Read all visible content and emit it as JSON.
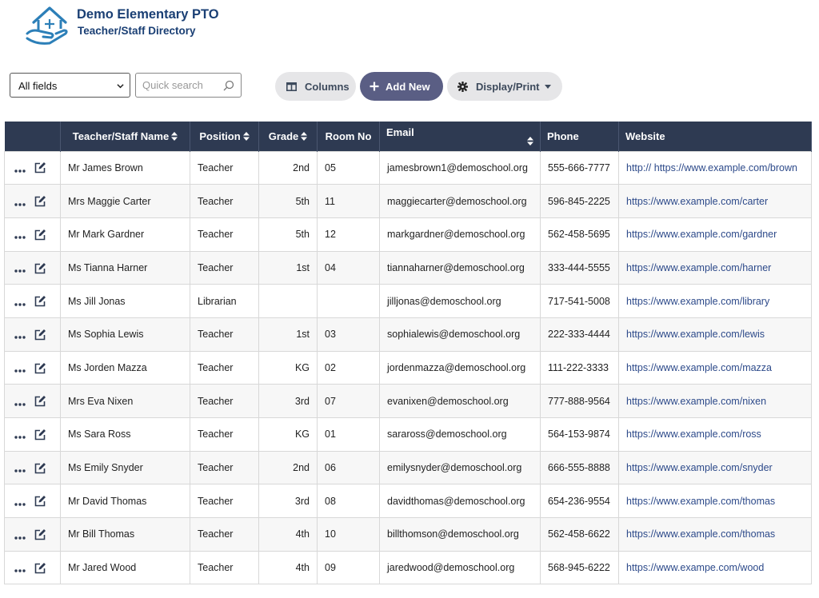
{
  "header": {
    "org_name": "Demo Elementary PTO",
    "page_name": "Teacher/Staff Directory",
    "logo_icon": "house-in-hand-icon"
  },
  "toolbar": {
    "field_select_value": "All fields",
    "search_placeholder": "Quick search",
    "columns_label": "Columns",
    "add_new_label": "Add New",
    "display_print_label": "Display/Print"
  },
  "colors": {
    "brand": "#1a3f74",
    "table_header_bg": "#2e3a52",
    "add_button_bg": "#5a5e84",
    "link_text": "#2d4a8a"
  },
  "table": {
    "headers": [
      "Teacher/Staff Name",
      "Position",
      "Grade",
      "Room No",
      "Email",
      "Phone",
      "Website"
    ],
    "rows": [
      {
        "name": "Mr James Brown",
        "position": "Teacher",
        "grade": "2nd",
        "room": "05",
        "email": "jamesbrown1@demoschool.org",
        "phone": "555-666-7777",
        "website": "http:// https://www.example.com/brown"
      },
      {
        "name": "Mrs Maggie Carter",
        "position": "Teacher",
        "grade": "5th",
        "room": "11",
        "email": "maggiecarter@demoschool.org",
        "phone": "596-845-2225",
        "website": "https://www.example.com/carter"
      },
      {
        "name": "Mr Mark Gardner",
        "position": "Teacher",
        "grade": "5th",
        "room": "12",
        "email": "markgardner@demoschool.org",
        "phone": "562-458-5695",
        "website": "https://www.example.com/gardner"
      },
      {
        "name": "Ms Tianna Harner",
        "position": "Teacher",
        "grade": "1st",
        "room": "04",
        "email": "tiannaharner@demoschool.org",
        "phone": "333-444-5555",
        "website": "https://www.example.com/harner"
      },
      {
        "name": "Ms Jill Jonas",
        "position": "Librarian",
        "grade": "",
        "room": "",
        "email": "jilljonas@demoschool.org",
        "phone": "717-541-5008",
        "website": "https://www.example.com/library"
      },
      {
        "name": "Ms Sophia Lewis",
        "position": "Teacher",
        "grade": "1st",
        "room": "03",
        "email": "sophialewis@demoschool.org",
        "phone": "222-333-4444",
        "website": "https://www.example.com/lewis"
      },
      {
        "name": "Ms Jorden Mazza",
        "position": "Teacher",
        "grade": "KG",
        "room": "02",
        "email": "jordenmazza@demoschool.org",
        "phone": "111-222-3333",
        "website": "https://www.example.com/mazza"
      },
      {
        "name": "Mrs Eva Nixen",
        "position": "Teacher",
        "grade": "3rd",
        "room": "07",
        "email": "evanixen@demoschool.org",
        "phone": "777-888-9564",
        "website": "https://www.example.com/nixen"
      },
      {
        "name": "Ms Sara Ross",
        "position": "Teacher",
        "grade": "KG",
        "room": "01",
        "email": "saraross@demoschool.org",
        "phone": "564-153-9874",
        "website": "https://www.example.com/ross"
      },
      {
        "name": "Ms Emily Snyder",
        "position": "Teacher",
        "grade": "2nd",
        "room": "06",
        "email": "emilysnyder@demoschool.org",
        "phone": "666-555-8888",
        "website": "https://www.example.com/snyder"
      },
      {
        "name": "Mr David Thomas",
        "position": "Teacher",
        "grade": "3rd",
        "room": "08",
        "email": "davidthomas@demoschool.org",
        "phone": "654-236-9554",
        "website": "https://www.example.com/thomas"
      },
      {
        "name": "Mr Bill Thomas",
        "position": "Teacher",
        "grade": "4th",
        "room": "10",
        "email": "billthomson@demoschool.org",
        "phone": "562-458-6622",
        "website": "https://www.example.com/thomas"
      },
      {
        "name": "Mr Jared Wood",
        "position": "Teacher",
        "grade": "4th",
        "room": "09",
        "email": "jaredwood@demoschool.org",
        "phone": "568-945-6222",
        "website": "https://www.exampe.com/wood"
      }
    ]
  }
}
